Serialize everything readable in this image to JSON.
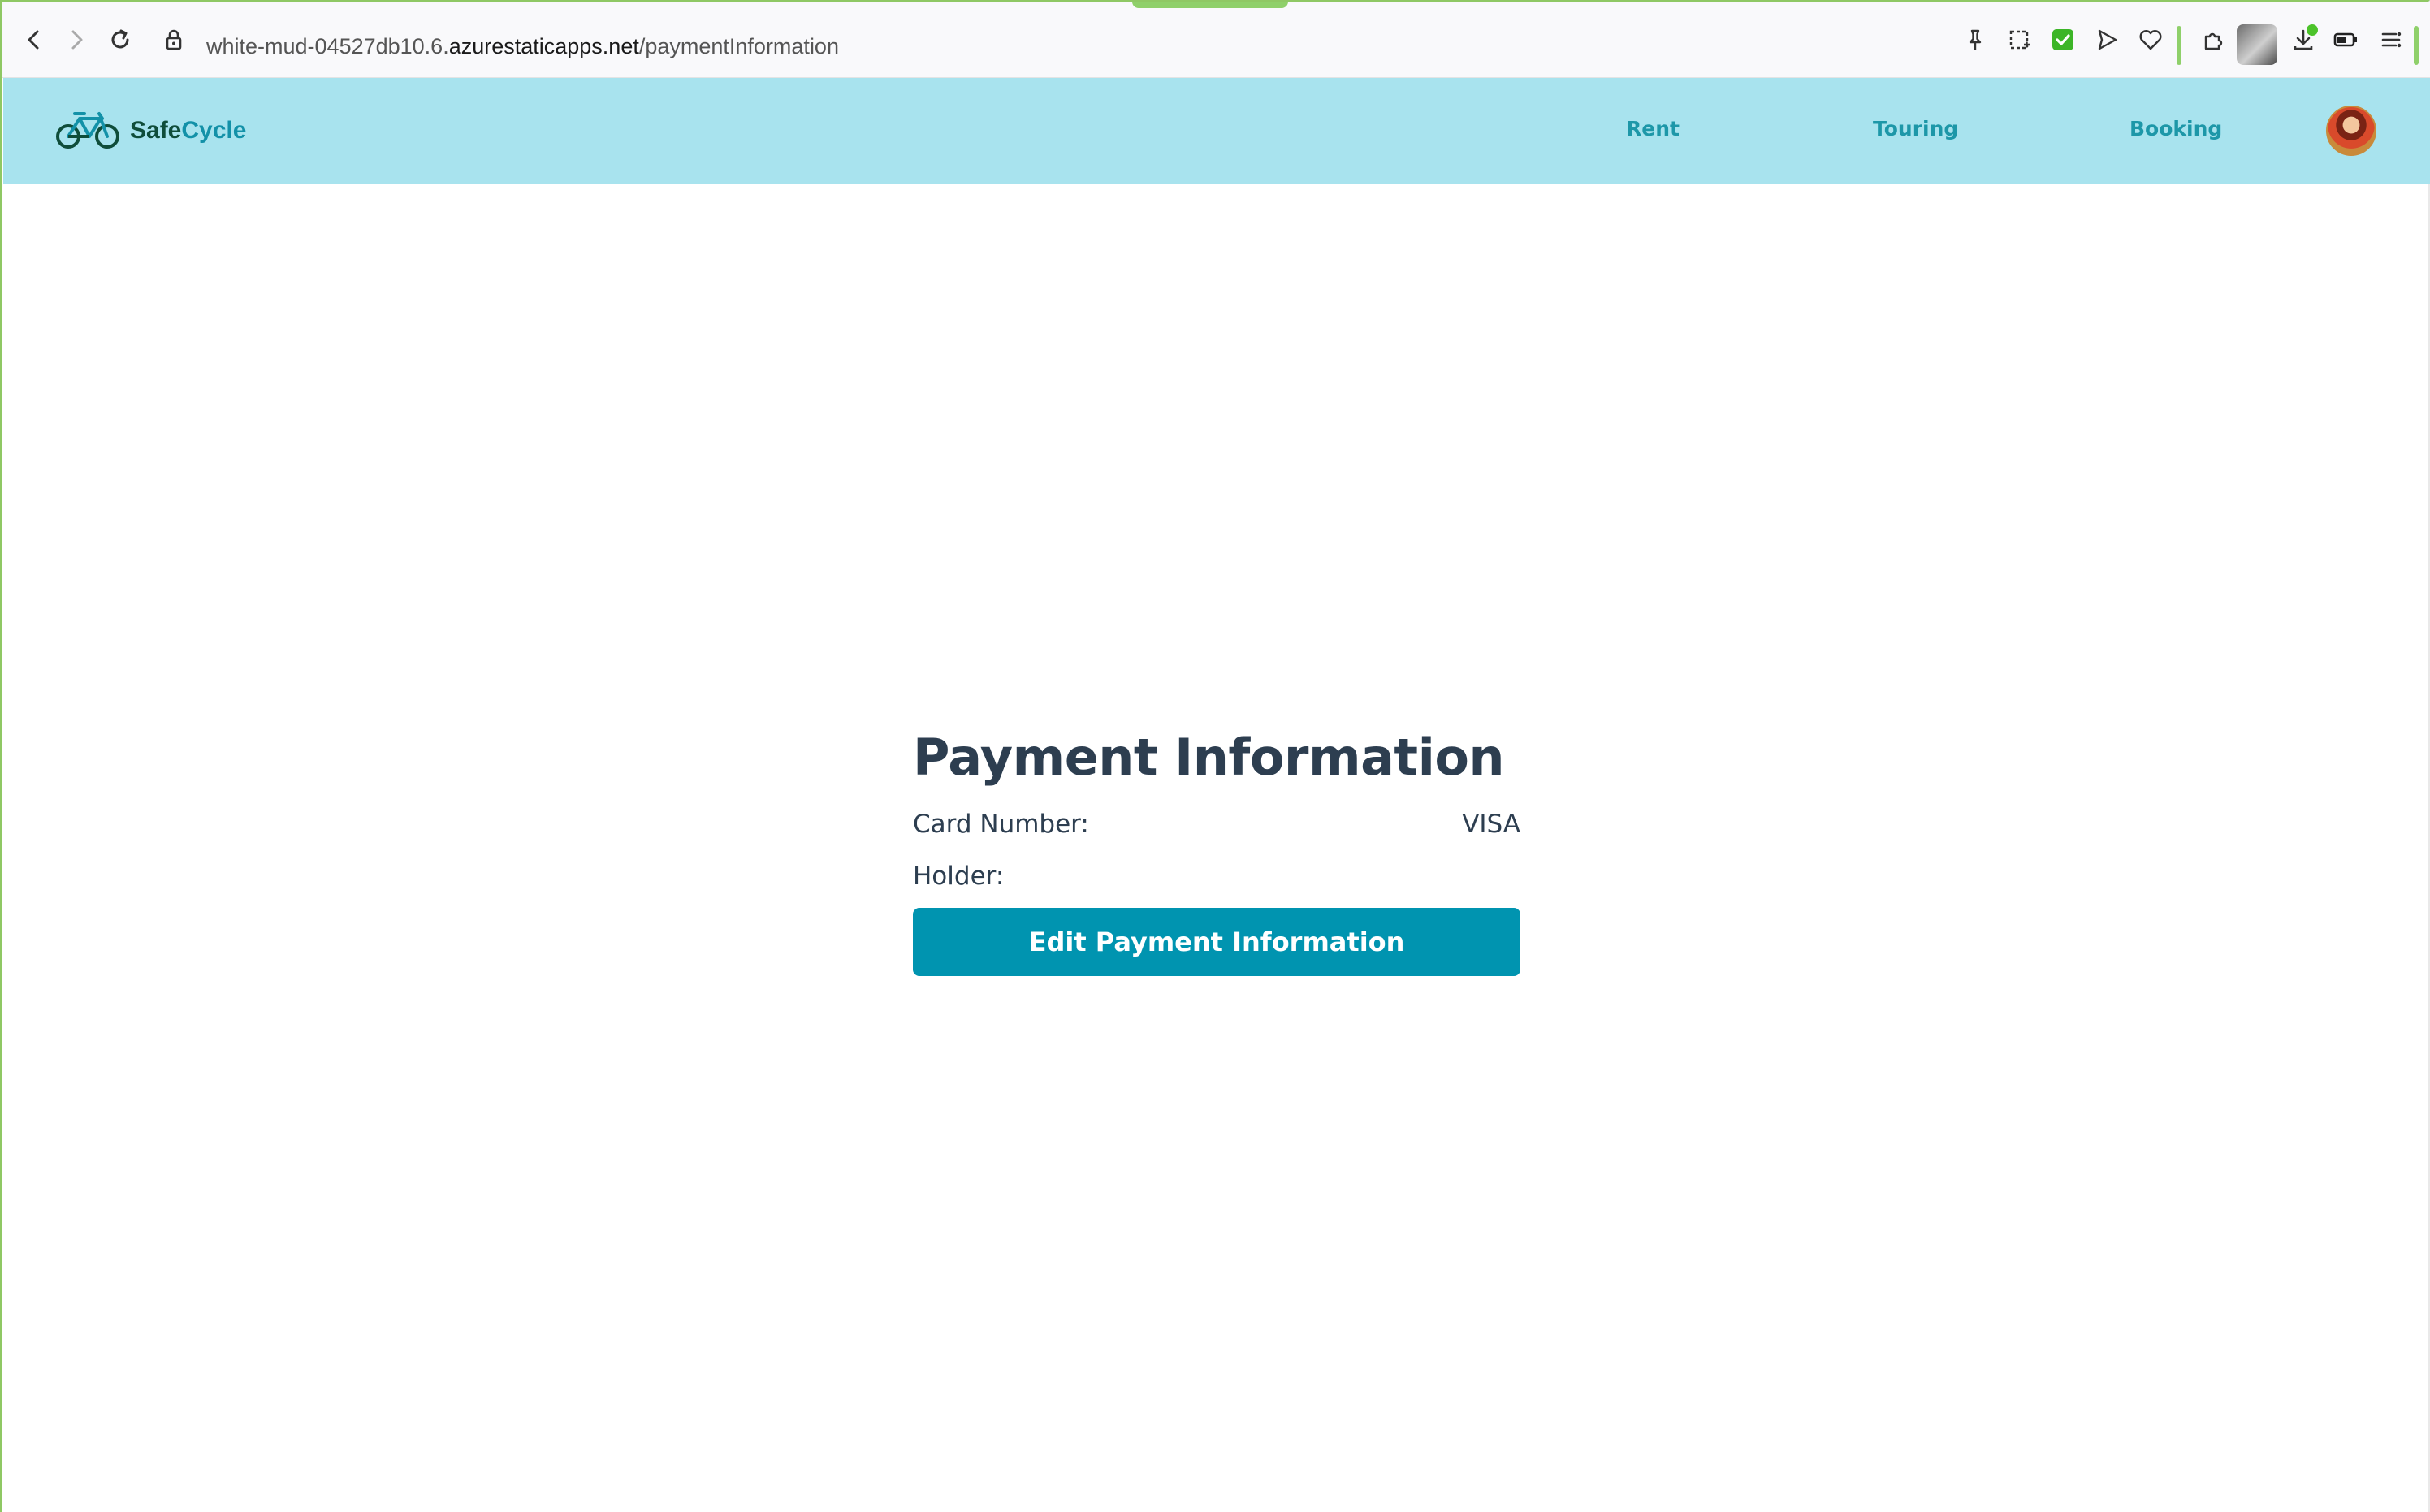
{
  "browser": {
    "url_prefix": "white-mud-04527db10.6.",
    "url_domain": "azurestaticapps.net",
    "url_path": "/paymentInformation",
    "icons": [
      "back-icon",
      "forward-icon",
      "reload-icon",
      "lock-icon",
      "pin-icon",
      "screenshot-icon",
      "shield-check-icon",
      "send-icon",
      "heart-icon",
      "extensions-icon",
      "profile-avatar",
      "download-icon",
      "battery-icon",
      "menu-icon"
    ],
    "accent": "#8fd06a"
  },
  "site": {
    "logo_part1": "Safe",
    "logo_part2": "Cycle",
    "nav": {
      "rent": "Rent",
      "touring": "Touring",
      "booking": "Booking"
    },
    "header_color": "#a8e3ee",
    "nav_color": "#1d97a8"
  },
  "payment": {
    "title": "Payment Information",
    "card_label": "Card Number:",
    "card_value": "VISA",
    "holder_label": "Holder:",
    "holder_value": "",
    "edit_button": "Edit Payment Information",
    "button_color": "#0094b0"
  }
}
